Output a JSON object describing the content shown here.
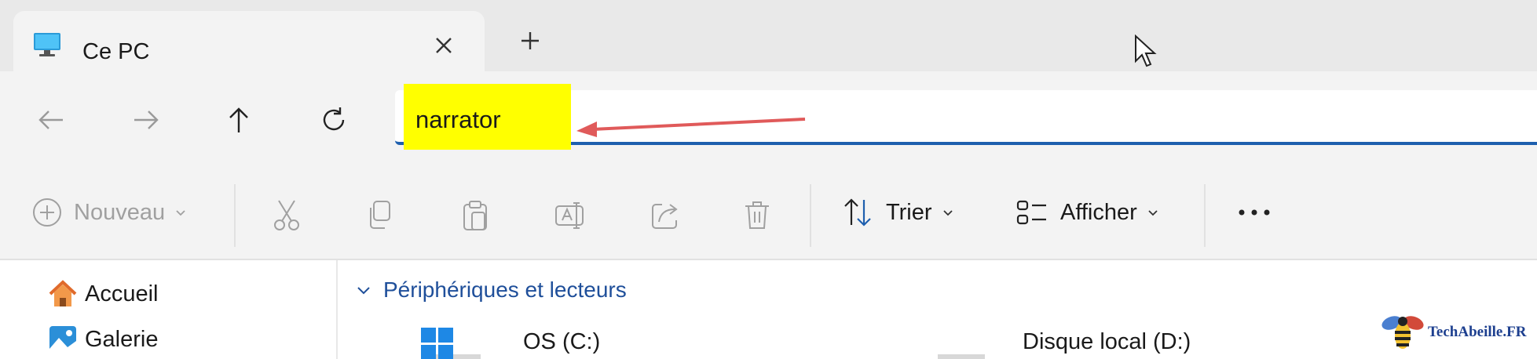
{
  "tab": {
    "title": "Ce PC",
    "icon": "monitor-icon"
  },
  "address": {
    "value": "narrator"
  },
  "commands": {
    "new_label": "Nouveau",
    "sort_label": "Trier",
    "view_label": "Afficher"
  },
  "sidebar": {
    "items": [
      {
        "label": "Accueil"
      },
      {
        "label": "Galerie"
      }
    ]
  },
  "main": {
    "section_title": "Périphériques et lecteurs",
    "drives": [
      {
        "label": "OS (C:)"
      },
      {
        "label": "Disque local (D:)"
      }
    ]
  },
  "watermark": {
    "text": "TechAbeille.FR"
  },
  "colors": {
    "accent": "#1e5fae",
    "highlight": "#ffff00",
    "annotation_arrow": "#e05a5a",
    "section_text": "#1f4f9a"
  }
}
